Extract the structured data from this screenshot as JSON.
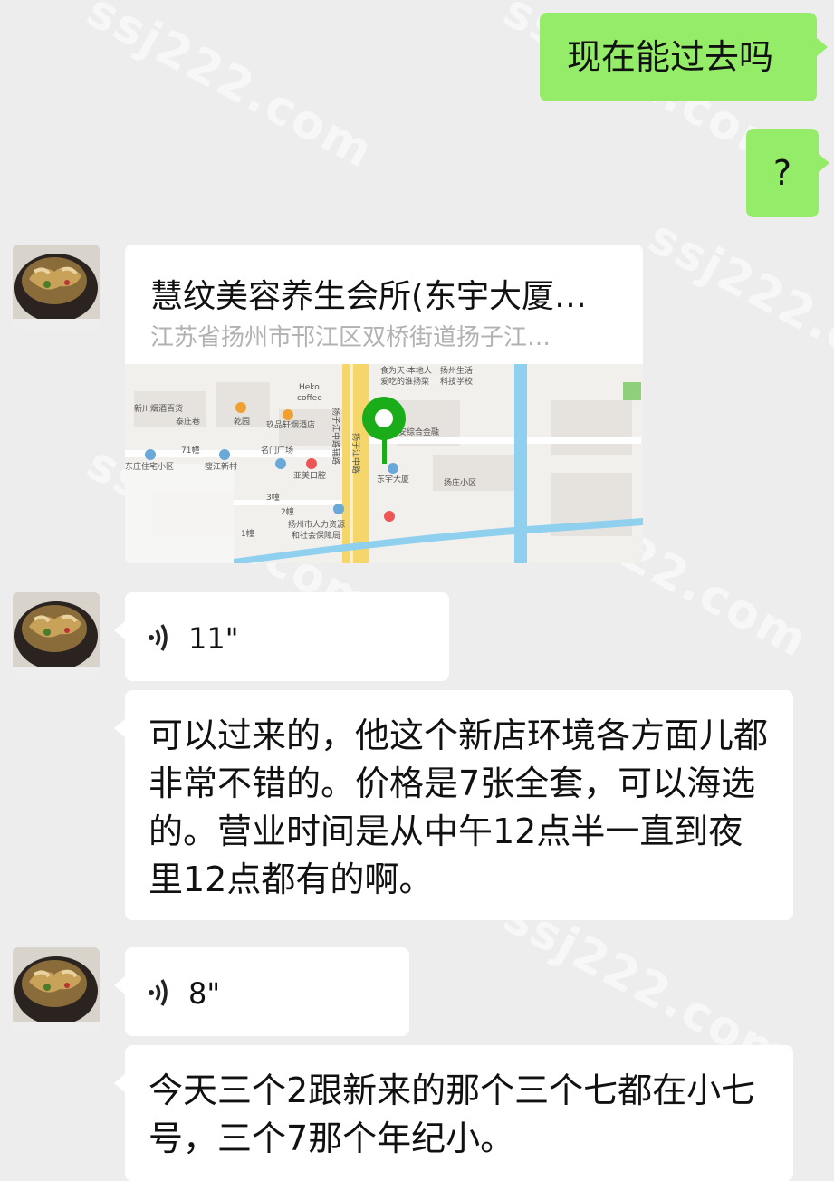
{
  "messages": {
    "m1": "现在能过去吗",
    "m2": "?",
    "location": {
      "title": "慧纹美容养生会所(东宇大厦…",
      "address": "江苏省扬州市邗江区双桥街道扬子江…",
      "map_labels": [
        "食为天·本地人",
        "爱吃的淮扬菜",
        "扬州生活",
        "科技学校",
        "Heko",
        "coffee",
        "新川烟酒百货",
        "泰庄巷",
        "乾园",
        "玖品轩烟酒店",
        "71幢",
        "名门广场",
        "亚美口腔",
        "东庄住宅小区",
        "瘦江新村",
        "安综合金融",
        "东宇大厦",
        "扬庄小区",
        "扬子江中路",
        "扬子江中路辅路",
        "扬州市人力资源",
        "和社会保障局",
        "3幢",
        "2幢",
        "1幢"
      ]
    },
    "voice1": "11\"",
    "m3": "可以过来的，他这个新店环境各方面儿都非常不错的。价格是7张全套，可以海选的。营业时间是从中午12点半一直到夜里12点都有的啊。",
    "voice2": "8\"",
    "m4": "今天三个2跟新来的那个三个七都在小七号，三个7那个年纪小。"
  },
  "watermark": "ssj222.com",
  "colors": {
    "sent_bubble": "#95ec69",
    "received_bubble": "#ffffff",
    "background": "#ededed",
    "map_pin": "#1aad19"
  }
}
